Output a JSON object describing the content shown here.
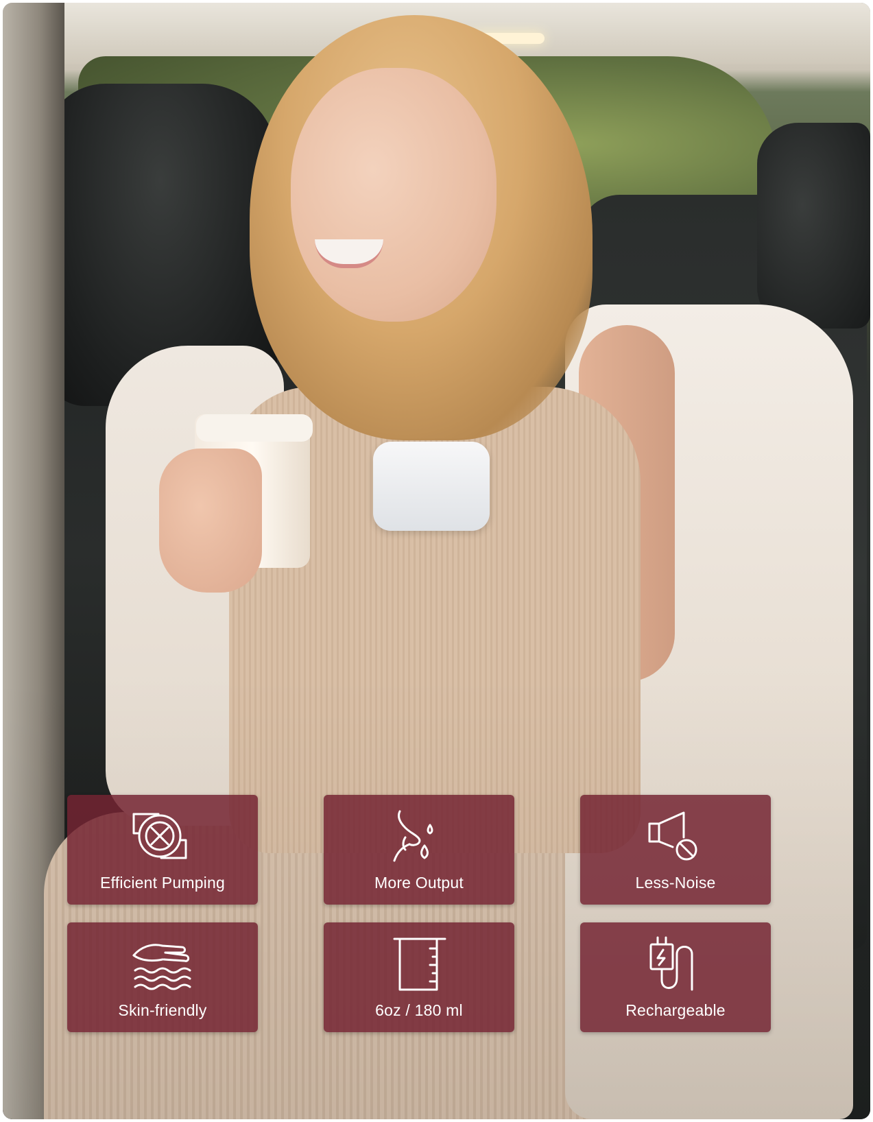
{
  "features": [
    {
      "label": "Efficient Pumping",
      "icon": "suction-fan-icon"
    },
    {
      "label": "More Output",
      "icon": "breast-milk-drops-icon"
    },
    {
      "label": "Less-Noise",
      "icon": "speaker-mute-icon"
    },
    {
      "label": "Skin-friendly",
      "icon": "hand-waves-icon"
    },
    {
      "label": "6oz / 180 ml",
      "icon": "measuring-cup-icon"
    },
    {
      "label": "Rechargeable",
      "icon": "battery-plug-icon"
    }
  ],
  "colors": {
    "tile_background": "#742432",
    "tile_text": "#ffffff"
  }
}
